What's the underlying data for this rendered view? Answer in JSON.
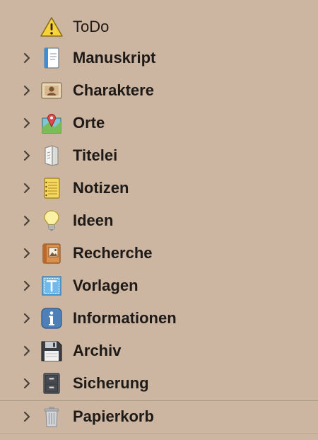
{
  "binder": {
    "items": [
      {
        "label": "ToDo",
        "icon": "warning-icon",
        "expandable": false
      },
      {
        "label": "Manuskript",
        "icon": "manuscript-icon",
        "expandable": true
      },
      {
        "label": "Charaktere",
        "icon": "character-card-icon",
        "expandable": true
      },
      {
        "label": "Orte",
        "icon": "map-pin-icon",
        "expandable": true
      },
      {
        "label": "Titelei",
        "icon": "front-matter-icon",
        "expandable": true
      },
      {
        "label": "Notizen",
        "icon": "notepad-icon",
        "expandable": true
      },
      {
        "label": "Ideen",
        "icon": "lightbulb-icon",
        "expandable": true
      },
      {
        "label": "Recherche",
        "icon": "research-book-icon",
        "expandable": true
      },
      {
        "label": "Vorlagen",
        "icon": "template-icon",
        "expandable": true
      },
      {
        "label": "Informationen",
        "icon": "info-icon",
        "expandable": true
      },
      {
        "label": "Archiv",
        "icon": "floppy-disk-icon",
        "expandable": true
      },
      {
        "label": "Sicherung",
        "icon": "filing-cabinet-icon",
        "expandable": true
      },
      {
        "label": "Papierkorb",
        "icon": "trash-icon",
        "expandable": true
      }
    ]
  },
  "colors": {
    "background": "#cdb6a1",
    "text": "#1e1a17",
    "chevron": "#4b423b",
    "divider": "#a79584"
  }
}
